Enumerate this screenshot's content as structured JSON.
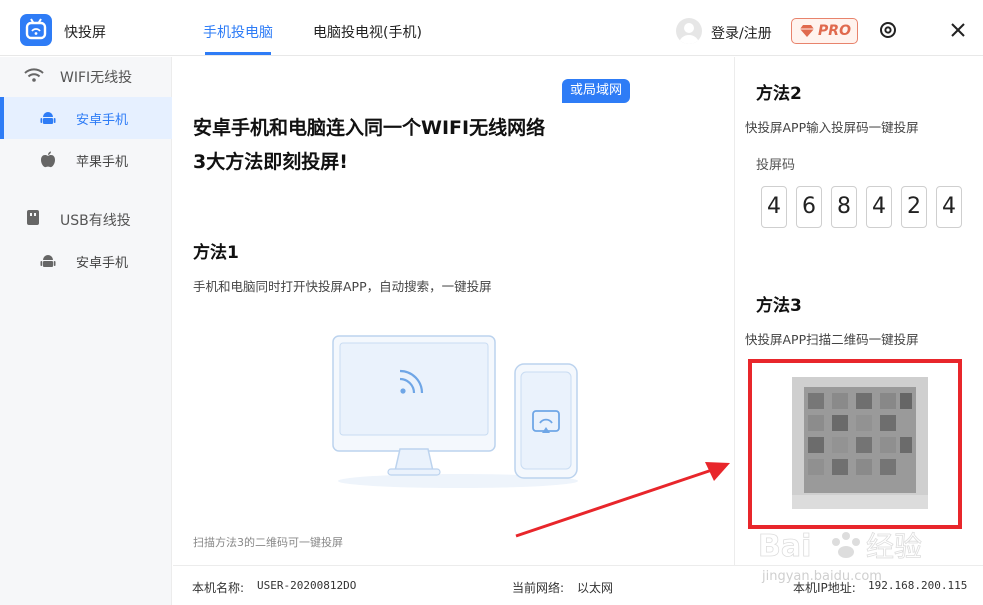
{
  "app": {
    "title": "快投屏"
  },
  "tabs": [
    {
      "label": "手机投电脑",
      "active": true
    },
    {
      "label": "电脑投电视(手机)",
      "active": false
    }
  ],
  "header": {
    "login_label": "登录/注册",
    "pro_label": "PRO"
  },
  "sidebar": {
    "groups": [
      {
        "label": "WIFI无线投",
        "icon": "wifi-icon"
      },
      {
        "label": "USB有线投",
        "icon": "usb-icon"
      }
    ],
    "items": [
      {
        "label": "安卓手机",
        "icon": "android-icon",
        "active": true
      },
      {
        "label": "苹果手机",
        "icon": "apple-icon",
        "active": false
      },
      {
        "label": "安卓手机",
        "icon": "android-icon",
        "active": false
      }
    ]
  },
  "main": {
    "lan_badge": "或局域网",
    "headline_line1": "安卓手机和电脑连入同一个WIFI无线网络",
    "headline_line2": "3大方法即刻投屏!",
    "method1_title": "方法1",
    "method1_desc": "手机和电脑同时打开快投屏APP，自动搜索，一键投屏",
    "hint": "扫描方法3的二维码可一键投屏"
  },
  "right": {
    "method2_title": "方法2",
    "method2_desc": "快投屏APP输入投屏码一键投屏",
    "code_label": "投屏码",
    "code_digits": [
      "4",
      "6",
      "8",
      "4",
      "2",
      "4"
    ],
    "method3_title": "方法3",
    "method3_desc": "快投屏APP扫描二维码一键投屏"
  },
  "footer": {
    "machine_name_label": "本机名称:",
    "machine_name": "USER-20200812DO",
    "network_label": "当前网络:",
    "network": "以太网",
    "ip_label": "本机IP地址:",
    "ip": "192.168.200.115"
  },
  "colors": {
    "accent": "#2e7cf6",
    "highlight_red": "#e8262b",
    "pro": "#e06a4e"
  }
}
